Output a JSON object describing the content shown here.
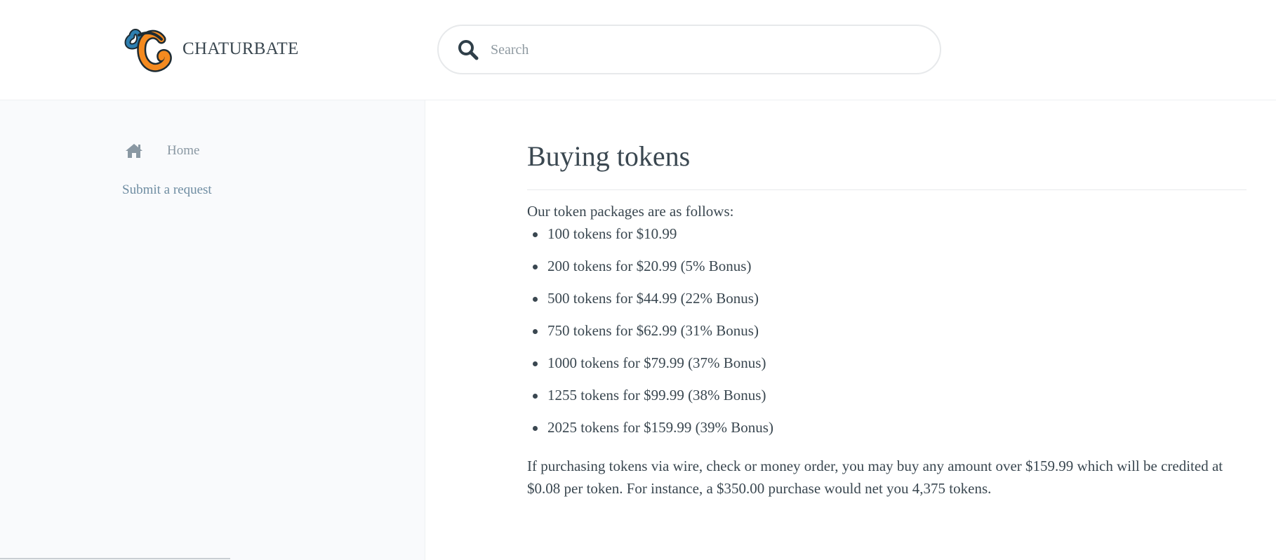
{
  "header": {
    "brand": "CHATURBATE",
    "search": {
      "placeholder": "Search",
      "value": ""
    }
  },
  "sidebar": {
    "home_label": "Home",
    "submit_request_label": "Submit a request"
  },
  "article": {
    "title": "Buying tokens",
    "intro": "Our token packages are as follows:",
    "packages": [
      "100 tokens for $10.99",
      "200 tokens for $20.99 (5% Bonus)",
      "500 tokens for $44.99 (22% Bonus)",
      "750 tokens for $62.99 (31% Bonus)",
      "1000 tokens for $79.99 (37% Bonus)",
      "1255 tokens for $99.99 (38% Bonus)",
      "2025 tokens for $159.99 (39% Bonus)"
    ],
    "note": "If purchasing tokens via wire, check or money order, you may buy any amount over $159.99 which will be credited at $0.08 per token. For instance, a $350.00 purchase would net you 4,375 tokens."
  },
  "icons": {
    "logo": "chaturbate-logo-icon",
    "search": "search-icon",
    "home": "home-icon"
  },
  "colors": {
    "logo_orange": "#f48a1f",
    "logo_blue": "#2e7fb0",
    "text": "#3a4750",
    "link": "#6f8da2",
    "sidebar_bg": "#f9fafc"
  }
}
